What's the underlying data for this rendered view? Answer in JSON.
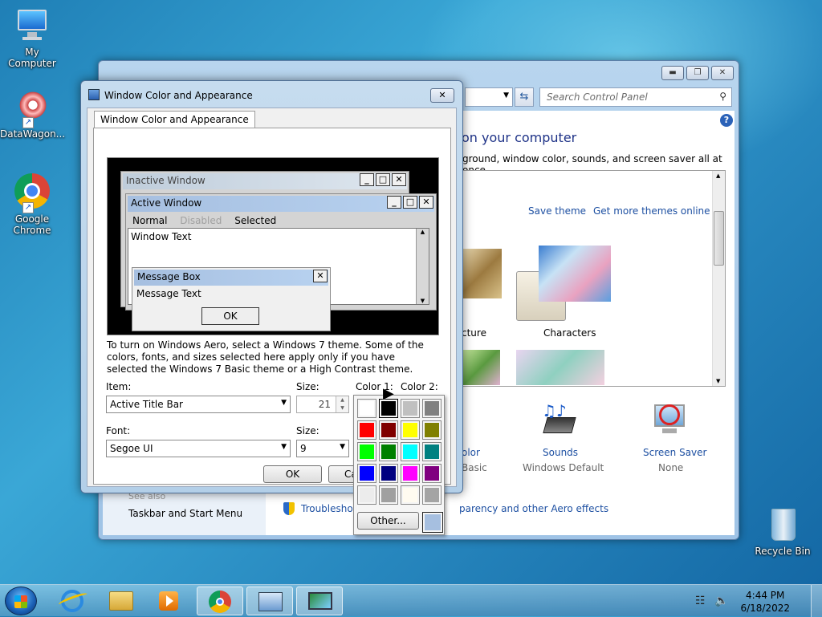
{
  "desktop": {
    "icons": [
      {
        "label": "My Computer"
      },
      {
        "label": "DataWagon..."
      },
      {
        "label": "Google Chrome"
      },
      {
        "label": "Recycle Bin"
      }
    ]
  },
  "control_panel": {
    "search_placeholder": "Search Control Panel",
    "heading": "on your computer",
    "description": "ground, window color, sounds, and screen saver all at once.",
    "save_theme": "Save theme",
    "get_more_themes": "Get more themes online",
    "theme_labels": [
      "cture",
      "Characters"
    ],
    "bottom_items": [
      {
        "title": "olor",
        "sub": "Basic"
      },
      {
        "title": "Sounds",
        "sub": "Windows Default"
      },
      {
        "title": "Screen Saver",
        "sub": "None"
      }
    ],
    "see_also": "See also",
    "taskbar_link": "Taskbar and Start Menu",
    "troubleshoot_link": "Troublesho",
    "aero_link": "parency and other Aero effects"
  },
  "dialog": {
    "title": "Window Color and Appearance",
    "tab": "Window Color and Appearance",
    "preview": {
      "inactive_title": "Inactive Window",
      "active_title": "Active Window",
      "menu_normal": "Normal",
      "menu_disabled": "Disabled",
      "menu_selected": "Selected",
      "window_text": "Window Text",
      "msgbox_title": "Message Box",
      "msgbox_text": "Message Text",
      "msgbox_ok": "OK"
    },
    "info": "To turn on Windows Aero, select a Windows 7 theme.  Some of the colors, fonts, and sizes selected here apply only if you have selected the Windows 7 Basic theme or a High Contrast theme.",
    "item_label": "Item:",
    "item_value": "Active Title Bar",
    "size_label": "Size:",
    "size_value": "21",
    "color1_label": "Color 1:",
    "color2_label": "Color 2:",
    "color1_value": "#a6bfe0",
    "color2_value": "#b8d2f0",
    "font_label": "Font:",
    "font_value": "Segoe UI",
    "font_size_label": "Size:",
    "font_size_value": "9",
    "ok": "OK",
    "cancel": "Ca",
    "palette": {
      "colors": [
        "#ffffff",
        "#000000",
        "#c0c0c0",
        "#808080",
        "#ff0000",
        "#800000",
        "#ffff00",
        "#808000",
        "#00ff00",
        "#008000",
        "#00ffff",
        "#008080",
        "#0000ff",
        "#000080",
        "#ff00ff",
        "#800080",
        "#ececec",
        "#a0a0a0",
        "#fffbf0",
        "#a4a4a4"
      ],
      "other": "Other...",
      "current": "#a6bfe0"
    }
  },
  "taskbar": {
    "time": "4:44 PM",
    "date": "6/18/2022"
  }
}
